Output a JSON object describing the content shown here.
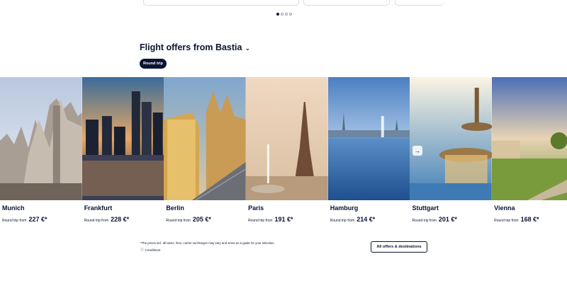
{
  "carousel": {
    "pages": 4,
    "active_page": 1
  },
  "offers": {
    "heading": "Flight offers from Bastia",
    "heading_icon": "chevron-down-icon",
    "filter_pill": "Round trip",
    "next_icon": "arrow-right-icon",
    "destinations": [
      {
        "city": "Munich",
        "round_trip_label": "Round trip from",
        "price": "227 €*"
      },
      {
        "city": "Frankfurt",
        "round_trip_label": "Round trip from",
        "price": "228 €*"
      },
      {
        "city": "Berlin",
        "round_trip_label": "Round trip from",
        "price": "205 €*"
      },
      {
        "city": "Paris",
        "round_trip_label": "Round trip from",
        "price": "191 €*"
      },
      {
        "city": "Hamburg",
        "round_trip_label": "Round trip from",
        "price": "214 €*"
      },
      {
        "city": "Stuttgart",
        "round_trip_label": "Round trip from",
        "price": "201 €*"
      },
      {
        "city": "Vienna",
        "round_trip_label": "Round trip from",
        "price": "168 €*"
      }
    ]
  },
  "footer": {
    "disclaimer": "*The prices incl. all taxes, fees, carrier surcharges may vary and serve as a guide for your selection.",
    "conditions_label": "Conditions",
    "conditions_icon": "info-icon",
    "all_offers_button": "All offers & destinations"
  }
}
